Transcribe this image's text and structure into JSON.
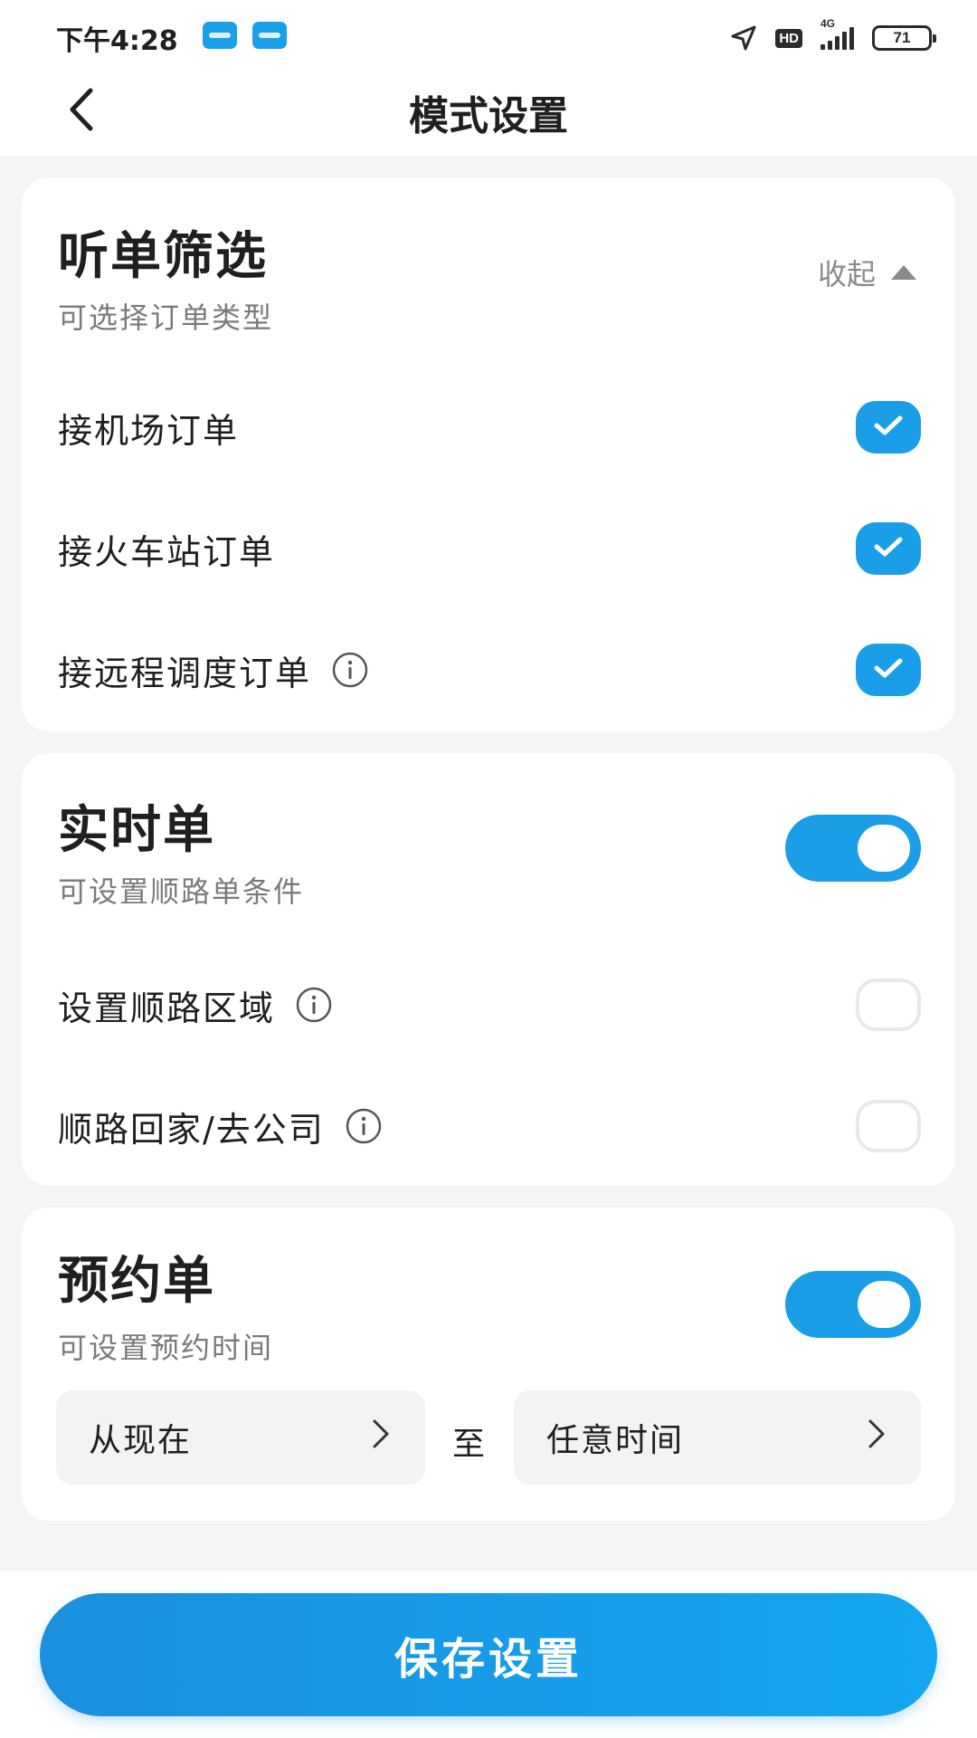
{
  "status_bar": {
    "time": "下午4:28",
    "hd_label": "HD",
    "network_label": "4G",
    "battery": "71"
  },
  "nav": {
    "title": "模式设置"
  },
  "filter_card": {
    "title": "听单筛选",
    "subtitle": "可选择订单类型",
    "collapse_label": "收起",
    "items": [
      {
        "label": "接机场订单",
        "checked": true,
        "has_info": false
      },
      {
        "label": "接火车站订单",
        "checked": true,
        "has_info": false
      },
      {
        "label": "接远程调度订单",
        "checked": true,
        "has_info": true
      }
    ]
  },
  "realtime_card": {
    "title": "实时单",
    "subtitle": "可设置顺路单条件",
    "toggle_on": true,
    "items": [
      {
        "label": "设置顺路区域",
        "checked": false,
        "has_info": true
      },
      {
        "label": "顺路回家/去公司",
        "checked": false,
        "has_info": true
      }
    ]
  },
  "reserve_card": {
    "title": "预约单",
    "subtitle": "可设置预约时间",
    "toggle_on": true,
    "from_label": "从现在",
    "to_word": "至",
    "to_label": "任意时间"
  },
  "save_button": "保存设置",
  "colors": {
    "accent": "#1a9ee8",
    "background": "#f4f5f7",
    "card": "#ffffff",
    "text_primary": "#1f1f1f",
    "text_secondary": "#7a7a7a"
  }
}
